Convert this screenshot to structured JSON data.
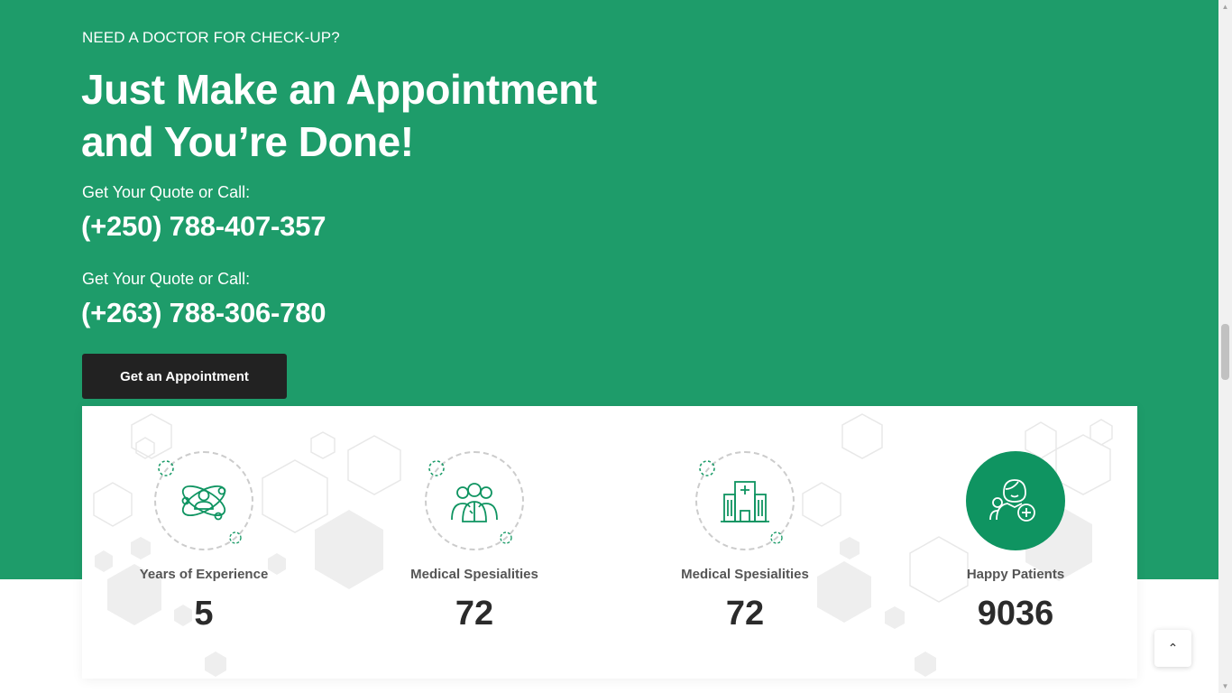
{
  "hero": {
    "eyebrow": "NEED A DOCTOR FOR CHECK-UP?",
    "headline_line1": "Just Make an Appointment",
    "headline_line2": "and You’re Done!",
    "contacts": [
      {
        "label": "Get Your Quote or Call:",
        "phone": "(+250) 788-407-357"
      },
      {
        "label": "Get Your Quote or Call:",
        "phone": "(+263) 788-306-780"
      }
    ],
    "cta_label": "Get an Appointment"
  },
  "stats": [
    {
      "label": "Years of Experience",
      "value": "5",
      "icon": "atom-doctor-icon"
    },
    {
      "label": "Medical Spesialities",
      "value": "72",
      "icon": "medical-team-icon"
    },
    {
      "label": "Medical Spesialities",
      "value": "72",
      "icon": "hospital-building-icon"
    },
    {
      "label": "Happy Patients",
      "value": "9036",
      "icon": "happy-patient-icon"
    }
  ],
  "colors": {
    "brand_green": "#1e9c6a",
    "icon_green": "#0f9461",
    "dark_button": "#222222",
    "text_dark": "#2b2b2b"
  },
  "back_to_top_icon": "chevron-up-icon"
}
